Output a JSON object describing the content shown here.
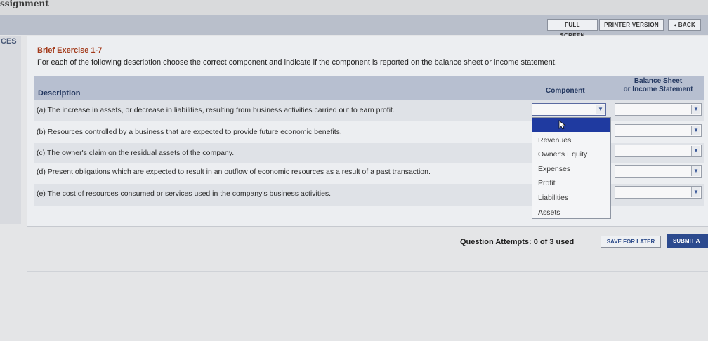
{
  "app": {
    "title": "ssignment"
  },
  "toolbar": {
    "full_screen": "FULL SCREEN",
    "printer_version": "PRINTER VERSION",
    "back": "◂ BACK"
  },
  "sidebar": {
    "tab_label": "CES"
  },
  "exercise": {
    "title": "Brief Exercise 1-7",
    "instructions": "For each of the following description choose the correct component and indicate if the component is reported on the balance sheet or income statement."
  },
  "table": {
    "headers": {
      "description": "Description",
      "component": "Component",
      "bs_line1": "Balance Sheet",
      "bs_line2": "or Income Statement"
    },
    "rows": [
      {
        "description": "(a) The increase in assets, or decrease in liabilities, resulting from business activities carried out to earn profit.",
        "component": "",
        "statement": ""
      },
      {
        "description": "(b) Resources controlled by a business that are expected to provide future economic benefits.",
        "component": "",
        "statement": ""
      },
      {
        "description": "(c) The owner's claim on the residual assets of the company.",
        "component": "",
        "statement": ""
      },
      {
        "description": "(d) Present obligations which are expected to result in an outflow of economic resources as a result of a past transaction.",
        "component": "",
        "statement": ""
      },
      {
        "description": "(e) The cost of resources consumed or services used in the company's business activities.",
        "component": "",
        "statement": ""
      }
    ]
  },
  "dropdown": {
    "options": [
      "",
      "Revenues",
      "Owner's Equity",
      "Expenses",
      "Profit",
      "Liabilities",
      "Assets"
    ],
    "highlighted_index": 0
  },
  "footer": {
    "attempts": "Question Attempts: 0 of 3 used",
    "save_for_later": "SAVE FOR LATER",
    "submit": "SUBMIT A"
  },
  "colors": {
    "accent": "#1f3aa0",
    "header_bg": "#b7bfd0",
    "title_red": "#a33a1a",
    "submit_bg": "#2c4a8e"
  }
}
